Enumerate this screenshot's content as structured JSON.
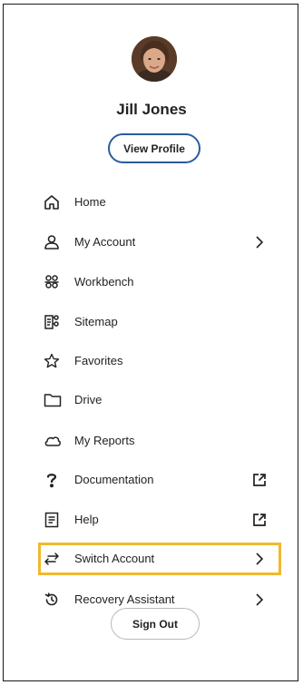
{
  "user": {
    "name": "Jill Jones",
    "view_profile_label": "View Profile"
  },
  "menu": {
    "items": [
      {
        "label": "Home",
        "icon": "home-icon"
      },
      {
        "label": "My Account",
        "icon": "person-icon",
        "trail": "chevron-right-icon"
      },
      {
        "label": "Workbench",
        "icon": "group-icon"
      },
      {
        "label": "Sitemap",
        "icon": "sitemap-icon"
      },
      {
        "label": "Favorites",
        "icon": "star-icon"
      },
      {
        "label": "Drive",
        "icon": "folder-icon"
      },
      {
        "label": "My Reports",
        "icon": "cloud-icon"
      },
      {
        "label": "Documentation",
        "icon": "question-icon",
        "trail": "external-link-icon"
      },
      {
        "label": "Help",
        "icon": "document-icon",
        "trail": "external-link-icon"
      },
      {
        "label": "Switch Account",
        "icon": "switch-arrows-icon",
        "trail": "chevron-right-icon",
        "highlighted": true
      },
      {
        "label": "Recovery Assistant",
        "icon": "restore-icon",
        "trail": "chevron-right-icon"
      }
    ]
  },
  "sign_out_label": "Sign Out",
  "colors": {
    "accent_border": "#2b5c9e",
    "highlight": "#f0b92e",
    "text": "#222222"
  }
}
